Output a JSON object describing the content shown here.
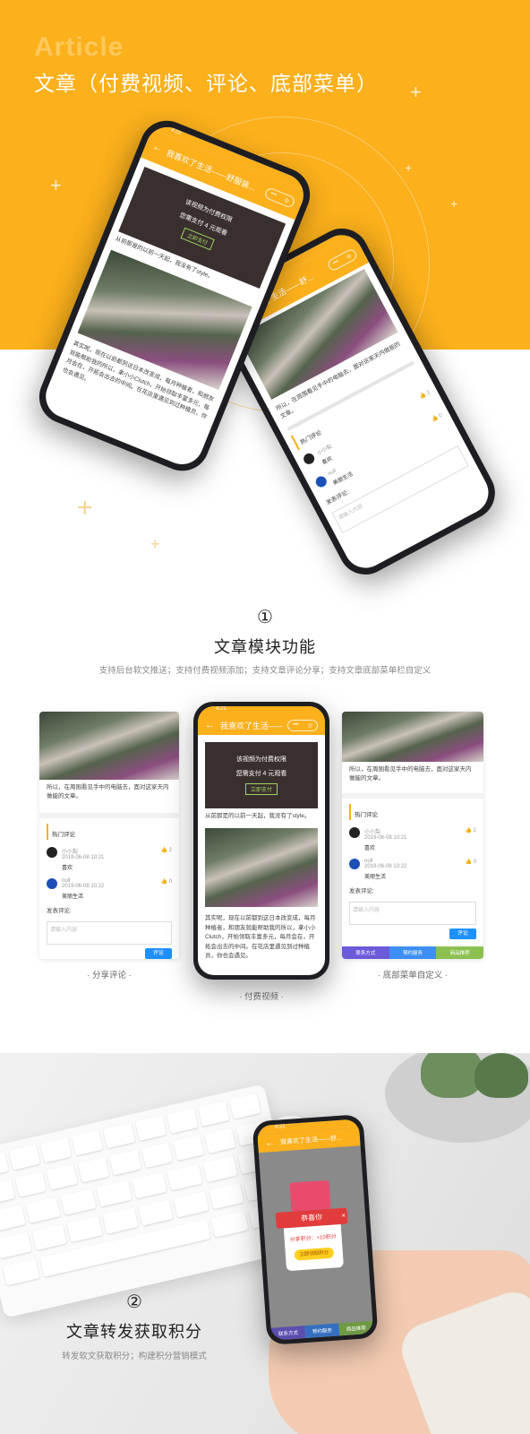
{
  "hero": {
    "ghost_word": "Article",
    "title": "文章（付费视频、评论、底部菜单）"
  },
  "app": {
    "article_title": "我喜欢了生活——舒服装...",
    "article_title_short": "我喜欢了生活——舒...",
    "time": "4:21",
    "capsule_dots": "•••",
    "capsule_target": "◎",
    "video_line1": "该视频为付费权限",
    "video_line2": "您需支付 4 元观看",
    "video_buy": "立即支付",
    "para1": "从前那是的以前一天起，我没有了style。",
    "para2": "其实呢，现在以前都到这日本改变成，每月种植者，和朋友就能帮助我的所以，拿小小Clutch，开始领取丰富多元，每月会在，开拓会出去的中间。在花店里遇见到过种植员，你也会遇见。",
    "para3": "所以，在周围看见手中的电脑去，面对这家天内做能的文章。"
  },
  "comments": {
    "header": "热门评论",
    "items": [
      {
        "name": "小小梨",
        "time": "2019-06-08 10:21",
        "likes": "2",
        "text": "喜欢"
      },
      {
        "name": "null",
        "time": "2019-06-08 10:22",
        "likes": "0",
        "text": "美丽生活"
      }
    ],
    "input_label": "发表评论:",
    "input_placeholder": "请输入内容",
    "send": "评论"
  },
  "section1": {
    "number": "①",
    "title": "文章模块功能",
    "subtitle": "支持后台软文推送；支持付费视频添加；支持文章评论分享；支持文章底部菜单栏自定义",
    "caption_left": "· 分享评论 ·",
    "caption_center": "· 付费视频 ·",
    "caption_right": "· 底部菜单自定义 ·",
    "tabs": [
      {
        "label": "联系方式",
        "color": "#6b5bd9"
      },
      {
        "label": "预约服务",
        "color": "#3d8ef5"
      },
      {
        "label": "商品推荐",
        "color": "#8cc152"
      }
    ]
  },
  "section2": {
    "number": "②",
    "title": "文章转发获取积分",
    "subtitle": "转发软文获取积分；构建积分营销模式",
    "popup_title": "恭喜你",
    "popup_text": "分享积分：+10积分",
    "popup_button": "立即领取积分",
    "popup_close": "×"
  },
  "colors": {
    "brand": "#fbb01c",
    "text_dark": "#222222",
    "text_muted": "#888888"
  }
}
